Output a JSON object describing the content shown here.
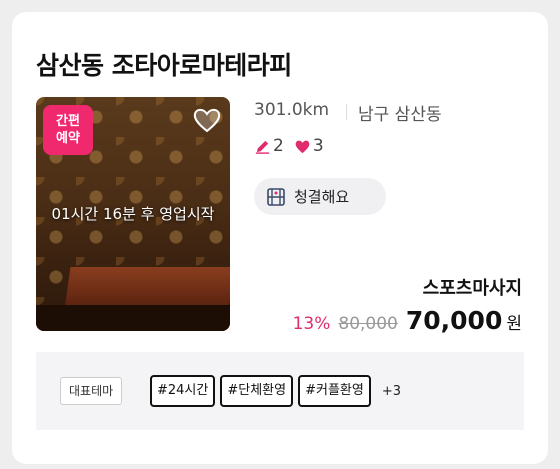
{
  "shop": {
    "name": "삼산동 조타아로마테라피",
    "distance": "301.0km",
    "area": "남구 삼산동",
    "review_count": "2",
    "like_count": "3",
    "clean_label": "청결해요",
    "category": "스포츠마사지"
  },
  "thumbnail": {
    "badge_line1": "간편",
    "badge_line2": "예약",
    "open_time": "01시간 16분 후 영업시작"
  },
  "price": {
    "discount": "13%",
    "original": "80,000",
    "final": "70,000",
    "currency": "원"
  },
  "tags": {
    "theme_label": "대표테마",
    "items": [
      "#24시간",
      "#단체환영",
      "#커플환영"
    ],
    "more": "+3"
  },
  "colors": {
    "accent": "#f0286d",
    "discount": "#e02c6f"
  },
  "icons": [
    "heart-outline-icon",
    "pencil-icon",
    "heart-icon",
    "clean-icon"
  ]
}
